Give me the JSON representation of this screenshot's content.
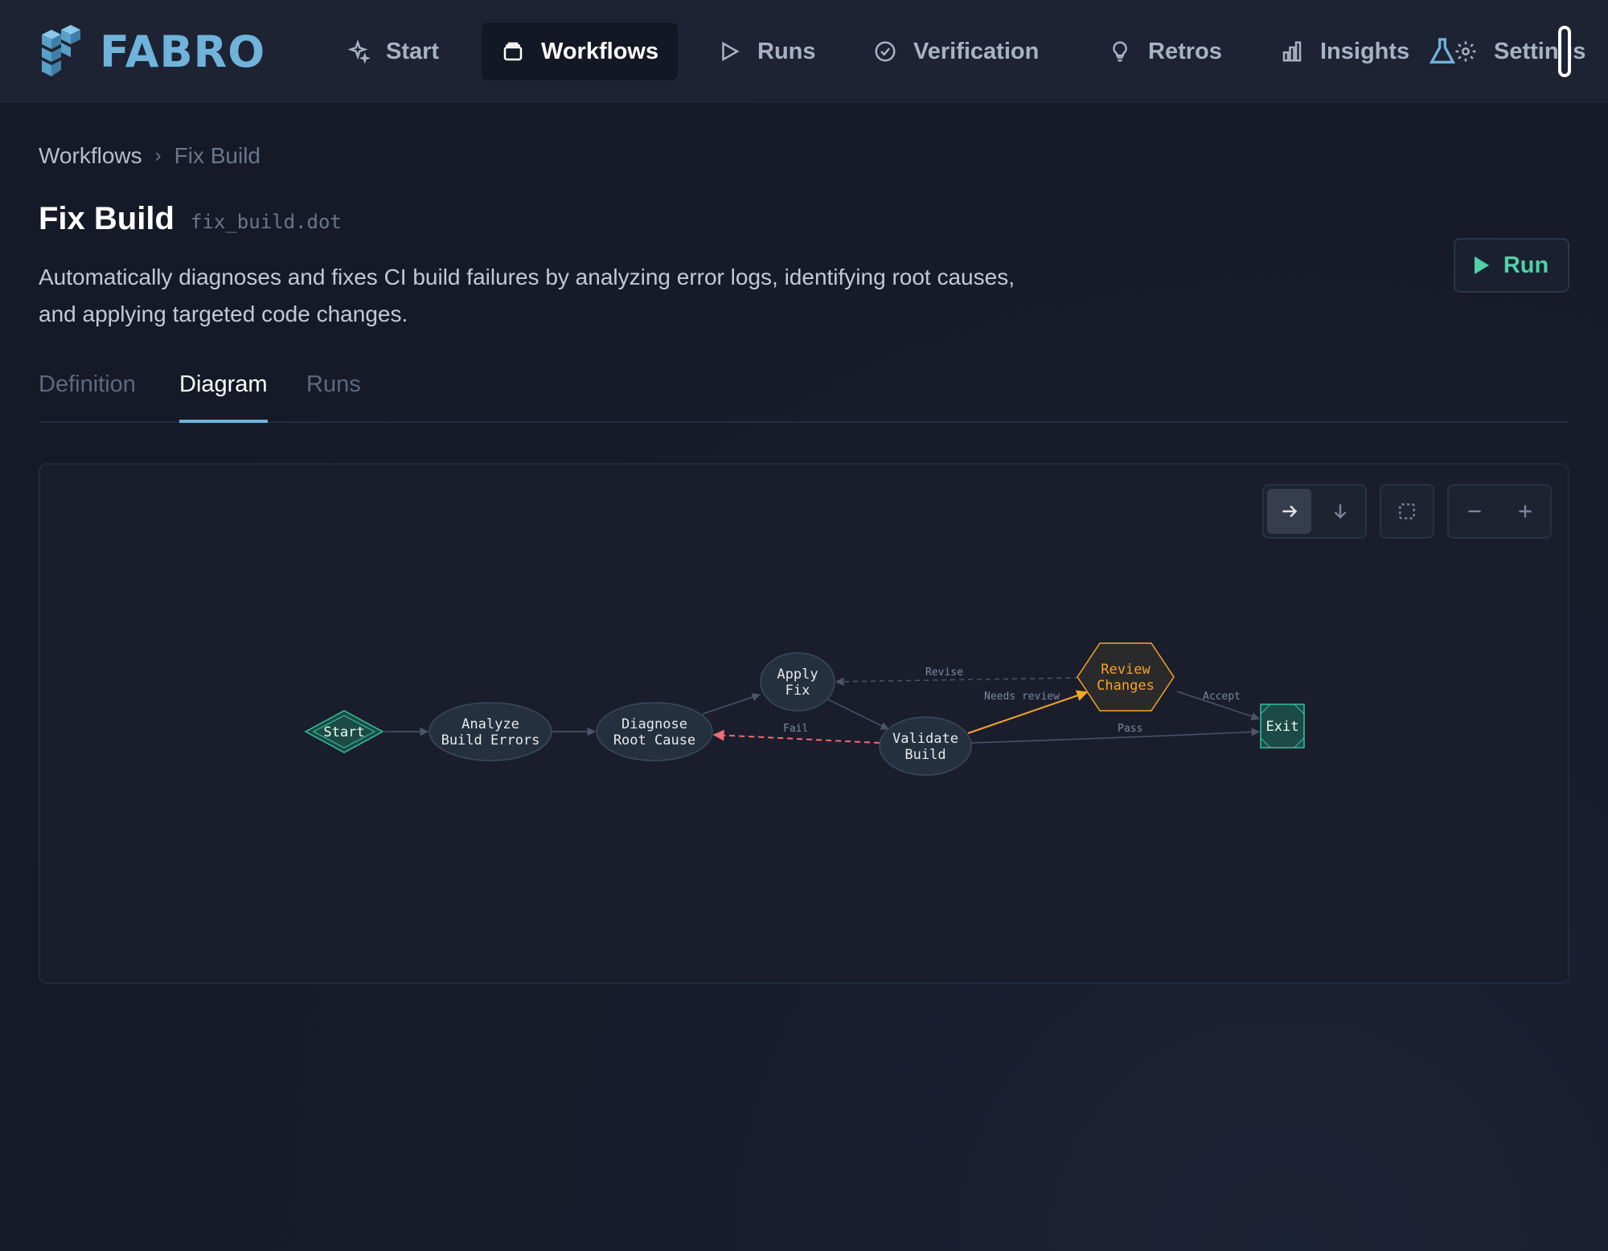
{
  "brand": {
    "name": "FABRO",
    "color": "#6fb3db"
  },
  "nav": {
    "items": [
      {
        "label": "Start",
        "icon": "sparkles-icon"
      },
      {
        "label": "Workflows",
        "icon": "stack-icon",
        "active": true
      },
      {
        "label": "Runs",
        "icon": "play-icon"
      },
      {
        "label": "Verification",
        "icon": "check-badge-icon"
      },
      {
        "label": "Retros",
        "icon": "lightbulb-icon"
      },
      {
        "label": "Insights",
        "icon": "bar-chart-icon"
      },
      {
        "label": "Settings",
        "icon": "gear-icon"
      }
    ],
    "extra_icon": "flask-icon"
  },
  "breadcrumb": {
    "parent": "Workflows",
    "current": "Fix Build"
  },
  "workflow": {
    "title": "Fix Build",
    "filename": "fix_build.dot",
    "description": "Automatically diagnoses and fixes CI build failures by analyzing error logs, identifying root causes, and applying targeted code changes.",
    "run_label": "Run"
  },
  "tabs": [
    {
      "label": "Definition"
    },
    {
      "label": "Diagram",
      "active": true
    },
    {
      "label": "Runs"
    }
  ],
  "diagram": {
    "controls": {
      "direction": [
        "arrow-right-icon",
        "arrow-down-icon"
      ],
      "fit": "fit-view-icon",
      "zoom": [
        "zoom-out-icon",
        "zoom-in-icon"
      ],
      "active_direction": "arrow-right-icon"
    },
    "nodes": {
      "start": {
        "line1": "Start"
      },
      "analyze": {
        "line1": "Analyze",
        "line2": "Build Errors"
      },
      "diagnose": {
        "line1": "Diagnose",
        "line2": "Root Cause"
      },
      "apply": {
        "line1": "Apply",
        "line2": "Fix"
      },
      "validate": {
        "line1": "Validate",
        "line2": "Build"
      },
      "review": {
        "line1": "Review",
        "line2": "Changes"
      },
      "exit": {
        "line1": "Exit"
      }
    },
    "edges": {
      "revise": "Revise",
      "needs_review": "Needs review",
      "accept": "Accept",
      "fail": "Fail",
      "pass": "Pass"
    },
    "colors": {
      "start_exit": "#2ec4a0",
      "review": "#f5a524",
      "fail": "#f06b73",
      "node_fill": "#24303d"
    }
  }
}
